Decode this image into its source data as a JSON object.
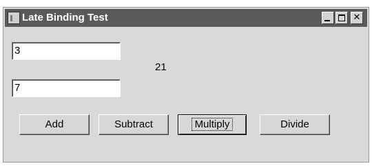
{
  "window": {
    "title": "Late Binding Test"
  },
  "inputs": {
    "first_value": "3",
    "second_value": "7"
  },
  "result": "21",
  "buttons": {
    "add": "Add",
    "subtract": "Subtract",
    "multiply": "Multiply",
    "divide": "Divide"
  },
  "icons": {
    "app": "window-icon",
    "minimize": "minimize-icon",
    "maximize": "maximize-icon",
    "close": "close-icon"
  }
}
